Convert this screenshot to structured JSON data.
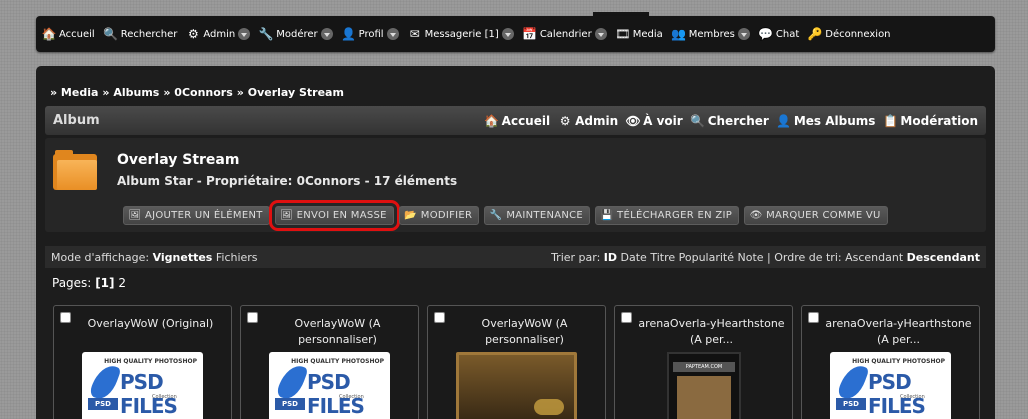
{
  "nav": {
    "items": [
      {
        "label": "Accueil",
        "icon": "home-icon",
        "glyph": "🏠",
        "caret": false
      },
      {
        "label": "Rechercher",
        "icon": "search-icon",
        "glyph": "🔍",
        "caret": false
      },
      {
        "label": "Admin",
        "icon": "gear-icon",
        "glyph": "⚙",
        "caret": true
      },
      {
        "label": "Modérer",
        "icon": "wrench-icon",
        "glyph": "🔧",
        "caret": true
      },
      {
        "label": "Profil",
        "icon": "user-icon",
        "glyph": "👤",
        "caret": true
      },
      {
        "label": "Messagerie [1]",
        "icon": "mail-icon",
        "glyph": "✉",
        "caret": true
      },
      {
        "label": "Calendrier",
        "icon": "calendar-icon",
        "glyph": "📅",
        "caret": true
      },
      {
        "label": "Media",
        "icon": "media-icon",
        "glyph": "🎞",
        "caret": false
      },
      {
        "label": "Membres",
        "icon": "members-icon",
        "glyph": "👥",
        "caret": true
      },
      {
        "label": "Chat",
        "icon": "chat-icon",
        "glyph": "💬",
        "caret": false
      },
      {
        "label": "Déconnexion",
        "icon": "key-icon",
        "glyph": "🔑",
        "caret": false
      }
    ]
  },
  "breadcrumb": {
    "items": [
      "» Media",
      "» Albums",
      "» 0Connors",
      "» Overlay Stream"
    ]
  },
  "albumbar": {
    "title": "Album",
    "links": [
      {
        "label": "Accueil",
        "icon": "home-icon",
        "glyph": "🏠"
      },
      {
        "label": "Admin",
        "icon": "gear-icon",
        "glyph": "⚙"
      },
      {
        "label": "À voir",
        "icon": "eye-icon",
        "glyph": "👁"
      },
      {
        "label": "Chercher",
        "icon": "search-icon",
        "glyph": "🔍"
      },
      {
        "label": "Mes Albums",
        "icon": "user-icon",
        "glyph": "👤"
      },
      {
        "label": "Modération",
        "icon": "list-icon",
        "glyph": "📋"
      }
    ]
  },
  "album": {
    "name": "Overlay Stream",
    "meta": "Album Star - Propriétaire: 0Connors - 17 éléments",
    "actions": [
      {
        "label": "AJOUTER UN ÉLÉMENT",
        "icon": "add-image-icon",
        "glyph": "🖼",
        "highlight": false
      },
      {
        "label": "ENVOI EN MASSE",
        "icon": "bulk-upload-icon",
        "glyph": "🖼",
        "highlight": true
      },
      {
        "label": "MODIFIER",
        "icon": "folder-edit-icon",
        "glyph": "📂",
        "highlight": false
      },
      {
        "label": "MAINTENANCE",
        "icon": "tools-icon",
        "glyph": "🔧",
        "highlight": false
      },
      {
        "label": "TÉLÉCHARGER EN ZIP",
        "icon": "disk-icon",
        "glyph": "💾",
        "highlight": false
      },
      {
        "label": "MARQUER COMME VU",
        "icon": "eye-icon",
        "glyph": "👁",
        "highlight": false
      }
    ]
  },
  "modebar": {
    "mode_label": "Mode d'affichage:",
    "mode_selected": "Vignettes",
    "mode_other": "Fichiers",
    "sort_label": "Trier par:",
    "sort_selected": "ID",
    "sort_options": "Date Titre Popularité Note",
    "order_label": "| Ordre de tri:",
    "order_asc": "Ascendant",
    "order_desc": "Descendant"
  },
  "pages": {
    "label": "Pages:",
    "current": "[1]",
    "other": "2"
  },
  "thumbs": [
    {
      "name": "OverlayWoW (Original)",
      "kind": "psd",
      "extra": "2"
    },
    {
      "name": "OverlayWoW (A personnaliser)",
      "kind": "psd",
      "extra": ""
    },
    {
      "name": "OverlayWoW (A personnaliser)",
      "kind": "overlay",
      "extra": ""
    },
    {
      "name": "arenaOverla-yHearthstone (A per...",
      "kind": "arena",
      "extra": ""
    },
    {
      "name": "arenaOverla-yHearthstone (A per...",
      "kind": "psd",
      "extra": ""
    }
  ],
  "psd_text": {
    "hq": "HIGH QUALITY PHOTOSHOP",
    "title": "PSD FILES",
    "tag": "PSD",
    "sub": "Collection"
  },
  "arena_text": "PAPTEAM.COM"
}
